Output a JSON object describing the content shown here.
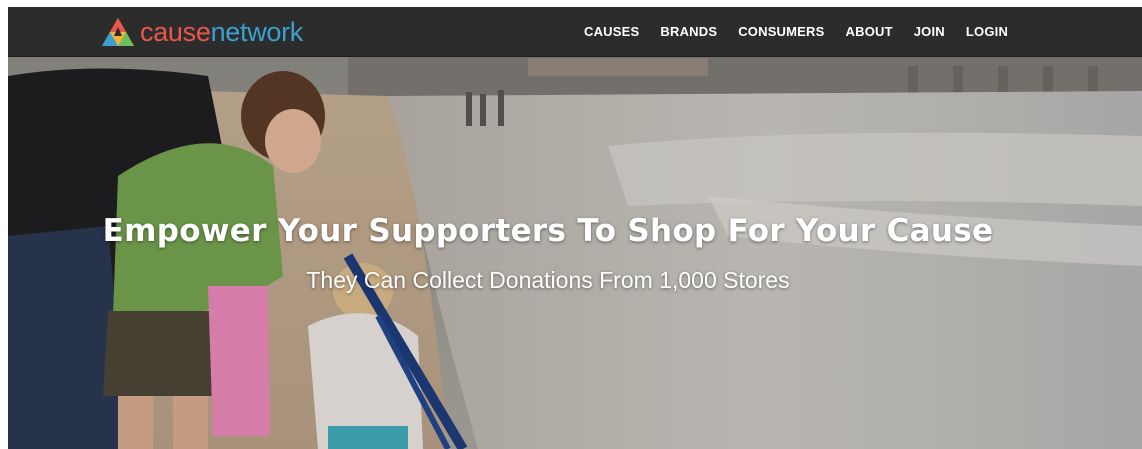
{
  "brand": {
    "name_part1": "cause",
    "name_part2": "network",
    "colors": {
      "part1": "#e8574b",
      "part2": "#3aa0d0",
      "navbar": "#2c2c2c"
    }
  },
  "nav": {
    "items": [
      {
        "label": "CAUSES"
      },
      {
        "label": "BRANDS"
      },
      {
        "label": "CONSUMERS"
      },
      {
        "label": "ABOUT"
      },
      {
        "label": "JOIN"
      },
      {
        "label": "LOGIN"
      }
    ]
  },
  "hero": {
    "title": "Empower Your Supporters To Shop For Your Cause",
    "subtitle": "They Can Collect Donations From 1,000 Stores"
  }
}
